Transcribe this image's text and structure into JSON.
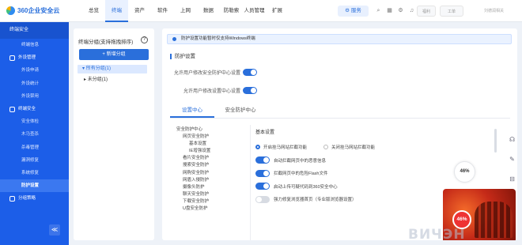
{
  "app": {
    "logo_text": "360企业安全云"
  },
  "topnav": {
    "items": [
      "总览",
      "终端",
      "资产",
      "软件",
      "上网",
      "数据",
      "防勒索",
      "人员管理",
      "扩展"
    ],
    "active_index": 1
  },
  "header": {
    "service_label": "服务",
    "badge_1": "福利",
    "badge_2": "工单",
    "user_text": "刘德润相关"
  },
  "sidebar": {
    "title": "终端安全",
    "items": [
      {
        "label": "终端信息",
        "type": "sub"
      },
      {
        "label": "外设管理",
        "type": "group"
      },
      {
        "label": "外设申请",
        "type": "sub"
      },
      {
        "label": "外设统计",
        "type": "sub"
      },
      {
        "label": "外设禁用",
        "type": "sub"
      },
      {
        "label": "终端安全",
        "type": "group"
      },
      {
        "label": "安全体检",
        "type": "sub"
      },
      {
        "label": "木马查杀",
        "type": "sub"
      },
      {
        "label": "杀毒管理",
        "type": "sub"
      },
      {
        "label": "漏洞修复",
        "type": "sub"
      },
      {
        "label": "系统修复",
        "type": "sub"
      },
      {
        "label": "防护设置",
        "type": "sub",
        "active": true
      },
      {
        "label": "分组策略",
        "type": "group"
      }
    ],
    "collapse_glyph": "≪"
  },
  "tree_panel": {
    "title": "终端分组(支持拖拽排序)",
    "add_button": "+ 新增分组",
    "root": "所有分组(1)",
    "child": "未分组(1)"
  },
  "main": {
    "notice": "防护设置功能暂时仅支持Windows终端",
    "section_title": "防护设置",
    "switches": [
      {
        "label": "允许用户修改安全防护中心设置",
        "on": true
      },
      {
        "label": "允许用户修改设置中心设置",
        "on": true
      }
    ],
    "tabs": [
      "设置中心",
      "安全防护中心"
    ],
    "active_tab": 0,
    "subtree": [
      "安全防护中心",
      "网页安全防护",
      "基本设置",
      "IE增强设置",
      "看片安全防护",
      "搜索安全防护",
      "网购安全防护",
      "网盾入侵防护",
      "摄像头防护",
      "聊天安全防护",
      "下载安全防护",
      "U盘安全防护"
    ],
    "settings": {
      "title": "基本设置",
      "radio_options": [
        "开启挂马网站拦截功能",
        "关闭挂马网站拦截功能"
      ],
      "radio_selected": 0,
      "rows": [
        {
          "label": "自动拦截网页中的恶意信息",
          "on": true
        },
        {
          "label": "拦截网页中的危险Flash文件",
          "on": true
        },
        {
          "label": "启动上传可疑代码到360安全中心",
          "on": true
        },
        {
          "label": "强力修复浏览器首页（专业版浏览器设置）",
          "on": false
        }
      ]
    }
  },
  "widget": {
    "percent_small": "46%",
    "percent_promo": "46%"
  },
  "rail_icons": [
    "headset-icon",
    "edit-icon",
    "collapse-icon"
  ],
  "watermark": "ВИЧЭН"
}
